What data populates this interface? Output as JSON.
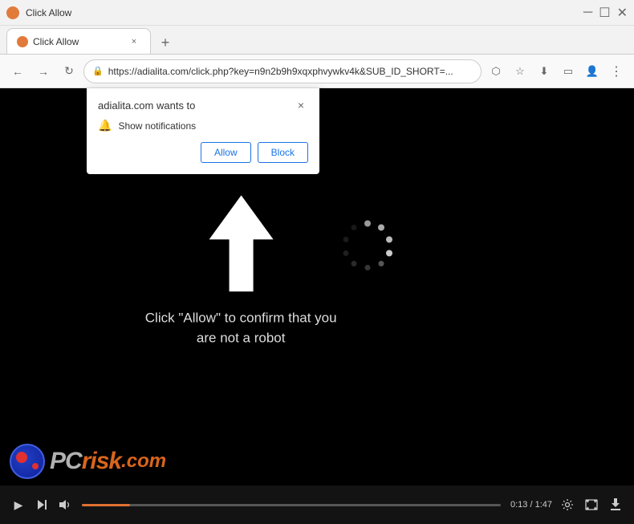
{
  "titlebar": {
    "title": "Click Allow"
  },
  "tab": {
    "label": "Click Allow",
    "close_label": "×",
    "new_tab_label": "+"
  },
  "toolbar": {
    "back_label": "←",
    "forward_label": "→",
    "reload_label": "↻",
    "url": "https://adialita.com/click.php?key=n9n2b9h9xqxphvywkv4k&SUB_ID_SHORT=...",
    "share_label": "⬡",
    "bookmark_label": "☆",
    "download_label": "⬇",
    "cast_label": "▭",
    "profile_label": "👤",
    "menu_label": "⋮"
  },
  "popup": {
    "title": "adialita.com wants to",
    "close_label": "×",
    "notification_text": "Show notifications",
    "allow_label": "Allow",
    "block_label": "Block"
  },
  "video": {
    "instruction_line1": "Click \"Allow\" to confirm that you",
    "instruction_line2": "are not a robot",
    "time_current": "0:13",
    "time_total": "1:47",
    "progress_pct": 11.5
  },
  "watermark": {
    "pc_text": "P̈C̈",
    "risk_text": "risk",
    "com_text": ".com"
  },
  "controls": {
    "play_label": "▶",
    "next_label": "⏭",
    "volume_label": "🔈",
    "settings_label": "⚙",
    "fullscreen_label": "⛶",
    "download_label": "⬇"
  }
}
